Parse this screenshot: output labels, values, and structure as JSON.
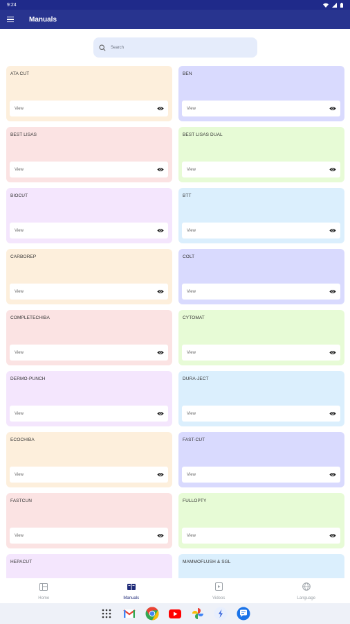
{
  "status_bar": {
    "time": "9:24"
  },
  "app_bar": {
    "title": "Manuals"
  },
  "search": {
    "placeholder": "Search"
  },
  "manuals": [
    {
      "name": "ATA CUT",
      "color": "#fdefdc"
    },
    {
      "name": "BEN",
      "color": "#d9dafe"
    },
    {
      "name": "BEST LISAS",
      "color": "#fbe3e3"
    },
    {
      "name": "BEST LISAS DUAL",
      "color": "#e7fbd6"
    },
    {
      "name": "BIOCUT",
      "color": "#f4e6fd"
    },
    {
      "name": "BTT",
      "color": "#dbeffd"
    },
    {
      "name": "CARBOREP",
      "color": "#fdefdc"
    },
    {
      "name": "COLT",
      "color": "#d9dafe"
    },
    {
      "name": "COMPLETECHIBA",
      "color": "#fbe3e3"
    },
    {
      "name": "CYTOMAT",
      "color": "#e7fbd6"
    },
    {
      "name": "DERMO-PUNCH",
      "color": "#f4e6fd"
    },
    {
      "name": "DURA-JECT",
      "color": "#dbeffd"
    },
    {
      "name": "ECOCHIBA",
      "color": "#fdefdc"
    },
    {
      "name": "FAST-CUT",
      "color": "#d9dafe"
    },
    {
      "name": "FASTCUN",
      "color": "#fbe3e3"
    },
    {
      "name": "FULLOPTY",
      "color": "#e7fbd6"
    },
    {
      "name": "HEPACUT",
      "color": "#f4e6fd"
    },
    {
      "name": "MAMMOFLUSH & SGL",
      "color": "#dbeffd"
    }
  ],
  "card": {
    "view_label": "View"
  },
  "bottom_nav": [
    {
      "label": "Home",
      "icon": "home-icon",
      "active": false
    },
    {
      "label": "Manuals",
      "icon": "book-icon",
      "active": true
    },
    {
      "label": "Videos",
      "icon": "video-icon",
      "active": false
    },
    {
      "label": "Language",
      "icon": "globe-icon",
      "active": false
    }
  ],
  "dock": [
    "apps-grid-icon",
    "gmail-icon",
    "chrome-icon",
    "youtube-icon",
    "photos-icon",
    "app-icon",
    "messages-icon"
  ],
  "colors": {
    "primary": "#28348f",
    "status_bar": "#1f2a8a",
    "search_bg": "#e5ecfb"
  }
}
